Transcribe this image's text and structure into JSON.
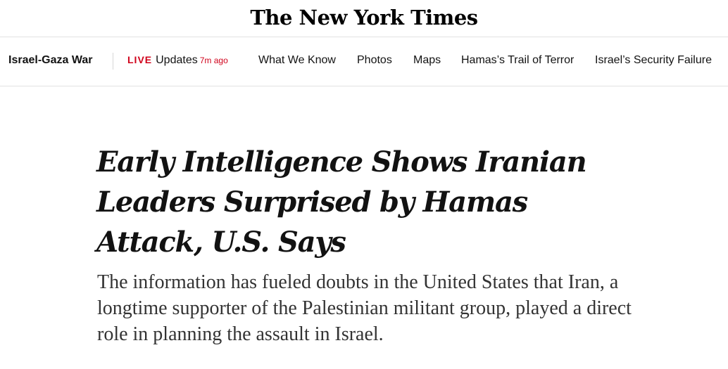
{
  "masthead": {
    "logo": "The New York Times"
  },
  "subnav": {
    "section": "Israel-Gaza War",
    "live": {
      "badge": "LIVE",
      "label": "Updates",
      "timestamp": "7m ago"
    },
    "links": [
      "What We Know",
      "Photos",
      "Maps",
      "Hamas’s Trail of Terror",
      "Israel’s Security Failure"
    ]
  },
  "article": {
    "headline": "Early Intelligence Shows Iranian Leaders Surprised by Hamas Attack, U.S. Says",
    "summary": "The information has fueled doubts in the United States that Iran, a longtime supporter of the Palestinian militant group, played a direct role in planning the assault in Israel."
  },
  "colors": {
    "live_accent": "#d0021b",
    "rule": "#e2e2e2",
    "text": "#121212"
  }
}
